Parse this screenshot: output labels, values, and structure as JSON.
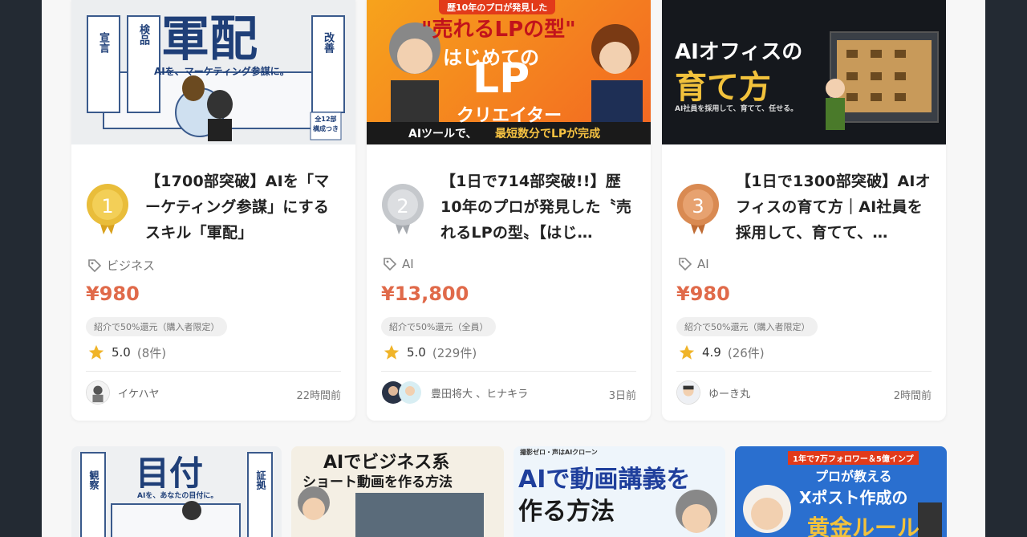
{
  "cards": [
    {
      "rank": "1",
      "medal_color": "#e0b02e",
      "title": "【1700部突破】AIを「マーケティング参謀」にするスキル「軍配」",
      "tag": "ビジネス",
      "price": "¥980",
      "badge": "紹介で50%還元（購入者限定）",
      "rating": "5.0",
      "rating_count": "(8件)",
      "author": "イケハヤ",
      "time": "22時間前",
      "thumb": {
        "headline": "軍配",
        "sub": "AIを、マーケティング参謀に。",
        "side_left_1": "宣言",
        "side_left_2": "検品",
        "side_right": "改善",
        "note": "全12部 構成つき"
      }
    },
    {
      "rank": "2",
      "medal_color": "#b8bcc2",
      "title": "【1日で714部突破!!】歴10年のプロが発見した〝売れるLPの型〟【はじ…",
      "tag": "AI",
      "price": "¥13,800",
      "badge": "紹介で50%還元（全員）",
      "rating": "5.0",
      "rating_count": "(229件)",
      "author": "豊田将大 、ヒナキラ",
      "time": "3日前",
      "thumb": {
        "top": "歴10年のプロが発見した",
        "headline_1": "\"売れるLPの型\"",
        "headline_2": "はじめての",
        "headline_3": "LP",
        "headline_4": "クリエイター",
        "bottom_1": "AIツールで、",
        "bottom_2": "最短数分でLPが完成"
      }
    },
    {
      "rank": "3",
      "medal_color": "#d9874e",
      "title": "【1日で1300部突破】AIオフィスの育て方｜AI社員を採用して、育てて、…",
      "tag": "AI",
      "price": "¥980",
      "badge": "紹介で50%還元（購入者限定）",
      "rating": "4.9",
      "rating_count": "(26件)",
      "author": "ゆーき丸",
      "time": "2時間前",
      "thumb": {
        "headline_1": "AIオフィスの",
        "headline_2": "育て方",
        "sub": "AI社員を採用して、育てて、任せる。"
      }
    }
  ],
  "row2": [
    {
      "headline": "目付",
      "sub": "AIを、あなたの目付に。",
      "side_left": "観察",
      "side_right": "証拠"
    },
    {
      "headline_1": "AIでビジネス系",
      "headline_2": "ショート動画を作る方法"
    },
    {
      "top": "撮影ゼロ・声はAIクローン",
      "headline_1": "AIで動画講義を",
      "headline_2": "作る方法"
    },
    {
      "top": "1年で7万フォロワー＆5億インプ",
      "headline_1": "プロが教える",
      "headline_2": "Xポスト作成の",
      "headline_3": "黄金ルール"
    }
  ]
}
